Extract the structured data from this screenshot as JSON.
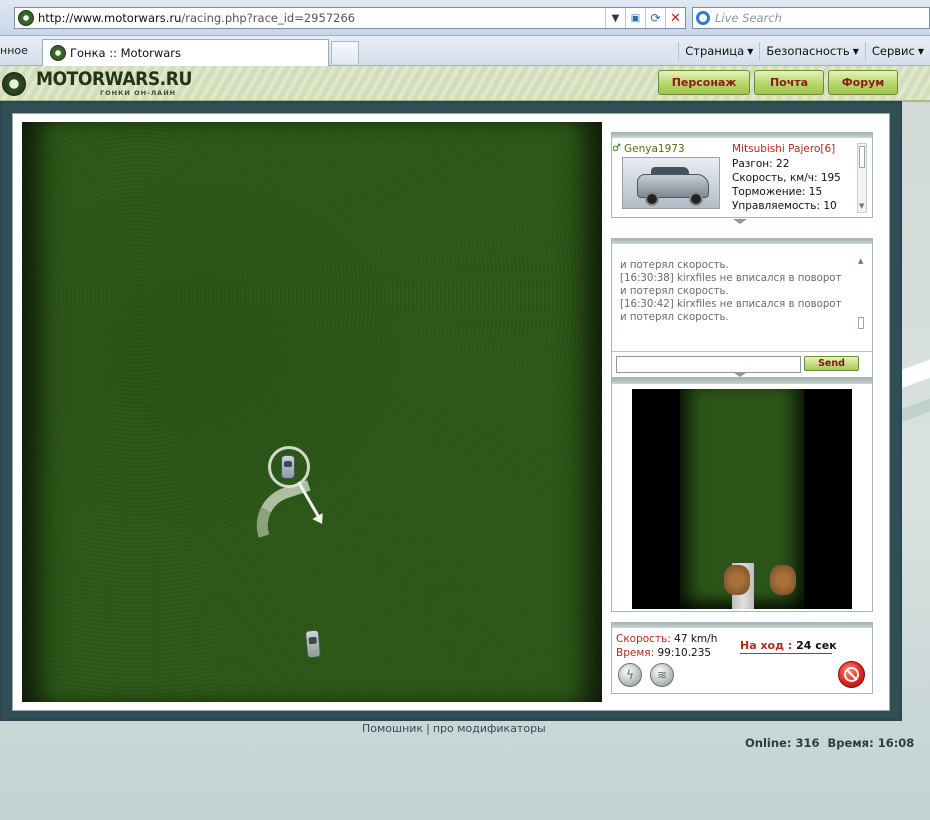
{
  "browser": {
    "url_host": "http://www.motorwars.ru",
    "url_path": "/racing.php?race_id=2957266",
    "search_placeholder": "Live Search",
    "tab_stub": "нное",
    "tab_title": "Гонка :: Motorwars",
    "menus": [
      "Страница",
      "Безопасность",
      "Сервис"
    ]
  },
  "site": {
    "logo": "MOTORWARS.RU",
    "logo_tagline": "ГОНКИ ОН-ЛАЙН",
    "nav": [
      "Персонаж",
      "Почта",
      "Форум"
    ]
  },
  "racer": {
    "name": "Genya1973",
    "car": "Mitsubishi Pajero[6]",
    "stats": [
      "Разгон: 22",
      "Скорость, км/ч: 195",
      "Торможение: 15",
      "Управляемость: 10"
    ]
  },
  "chat": {
    "messages": [
      "и потерял скорость.",
      "[16:30:38] kirxfiles не вписался в поворот",
      "и потерял скорость.",
      "[16:30:42] kirxfiles не вписался в поворот",
      "и потерял скорость."
    ],
    "send_label": "Send"
  },
  "status": {
    "speed_label": "Скорость:",
    "speed_value": "47 km/h",
    "time_label": "Время:",
    "time_value": "99:10.235",
    "turn_label": "На ход :",
    "turn_value": "24 сек"
  },
  "footer": {
    "link1": "Помошник",
    "separator": "|",
    "link2": "про модификаторы",
    "online_label": "Online:",
    "online_value": "316",
    "time_label": "Время:",
    "time_value": "16:08"
  },
  "colors": {
    "grass": "#2d5819",
    "frame": "#2f4e55",
    "nav_button": "#b7d66b",
    "label_red": "#b32a1c"
  }
}
